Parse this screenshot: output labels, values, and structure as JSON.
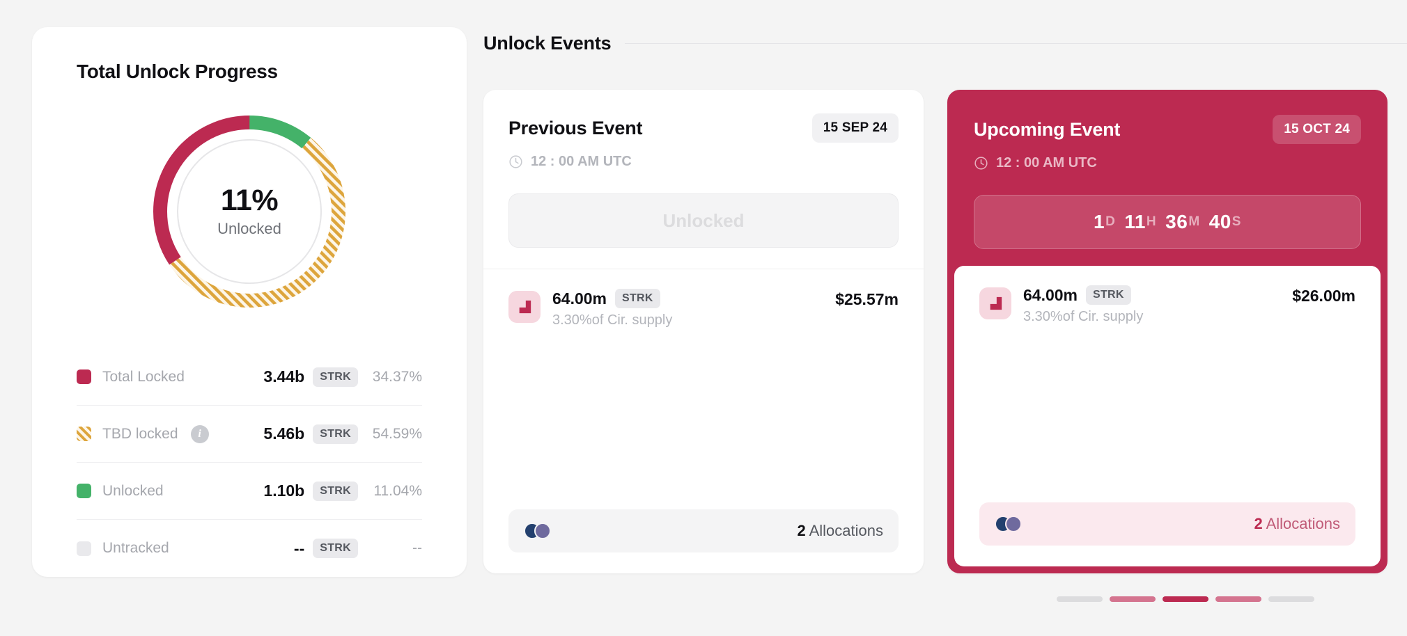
{
  "progress_card": {
    "title": "Total Unlock Progress",
    "donut": {
      "center_value": "11%",
      "center_label": "Unlocked"
    },
    "legend": [
      {
        "label": "Total Locked",
        "amount": "3.44b",
        "tag": "STRK",
        "percent": "34.37%",
        "color": "#bc2a51",
        "style": "solid",
        "info": false
      },
      {
        "label": "TBD locked",
        "amount": "5.46b",
        "tag": "STRK",
        "percent": "54.59%",
        "color": "#dda53c",
        "style": "hatched",
        "info": true,
        "info_icon": "info-icon"
      },
      {
        "label": "Unlocked",
        "amount": "1.10b",
        "tag": "STRK",
        "percent": "11.04%",
        "color": "#44b269",
        "style": "solid",
        "info": false
      },
      {
        "label": "Untracked",
        "amount": "--",
        "tag": "STRK",
        "percent": "--",
        "color": "#e9e9ec",
        "style": "solid",
        "info": false
      }
    ]
  },
  "events": {
    "section_title": "Unlock Events",
    "previous": {
      "name": "Previous Event",
      "date_badge": "15 SEP 24",
      "clock_icon": "clock-icon",
      "time": "12 : 00 AM UTC",
      "status_label": "Unlocked",
      "allocation": {
        "logo_icon": "token-logo-icon",
        "amount": "64.00m",
        "tag": "STRK",
        "subtitle": "3.30%of Cir. supply",
        "usd": "$25.57m"
      },
      "footer": {
        "count": "2",
        "label": "Allocations",
        "avatar_colors": [
          "#23406e",
          "#6f6a9e"
        ]
      }
    },
    "upcoming": {
      "name": "Upcoming Event",
      "date_badge": "15 OCT 24",
      "clock_icon": "clock-icon",
      "time": "12 : 00 AM UTC",
      "countdown": {
        "days": "1",
        "days_unit": "D",
        "hours": "11",
        "hours_unit": "H",
        "minutes": "36",
        "minutes_unit": "M",
        "seconds": "40",
        "seconds_unit": "S"
      },
      "allocation": {
        "logo_icon": "token-logo-icon",
        "amount": "64.00m",
        "tag": "STRK",
        "subtitle": "3.30%of Cir. supply",
        "usd": "$26.00m"
      },
      "footer": {
        "count": "2",
        "label": "Allocations",
        "avatar_colors": [
          "#23406e",
          "#6f6a9e"
        ]
      }
    },
    "pagination": {
      "dots": [
        "#dcdcde",
        "#d4748f",
        "#bc2a51",
        "#d4748f",
        "#dcdcde"
      ]
    }
  },
  "chart_data": {
    "type": "pie",
    "title": "Total Unlock Progress",
    "categories": [
      "Total Locked",
      "TBD locked",
      "Unlocked",
      "Untracked"
    ],
    "values": [
      34.37,
      54.59,
      11.04,
      0
    ],
    "value_labels": [
      "3.44b STRK",
      "5.46b STRK",
      "1.10b STRK",
      "-- STRK"
    ],
    "colors": [
      "#bc2a51",
      "#dda53c",
      "#44b269",
      "#e9e9ec"
    ],
    "center_text": "11%",
    "center_sub": "Unlocked",
    "unit": "%",
    "legend_position": "bottom"
  }
}
